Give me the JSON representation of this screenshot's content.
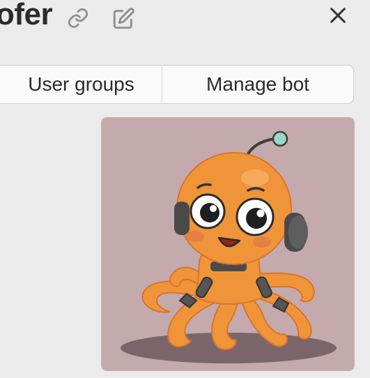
{
  "header": {
    "title_fragment": "ofer",
    "link_icon": "link-icon",
    "edit_icon": "edit-icon",
    "close_icon": "close-icon"
  },
  "tabs": [
    {
      "label": "User groups"
    },
    {
      "label": "Manage bot"
    }
  ],
  "avatar": {
    "description_icon": "octopus-robot-avatar",
    "background_color": "#c4aaad",
    "accent_color": "#f0943a"
  }
}
